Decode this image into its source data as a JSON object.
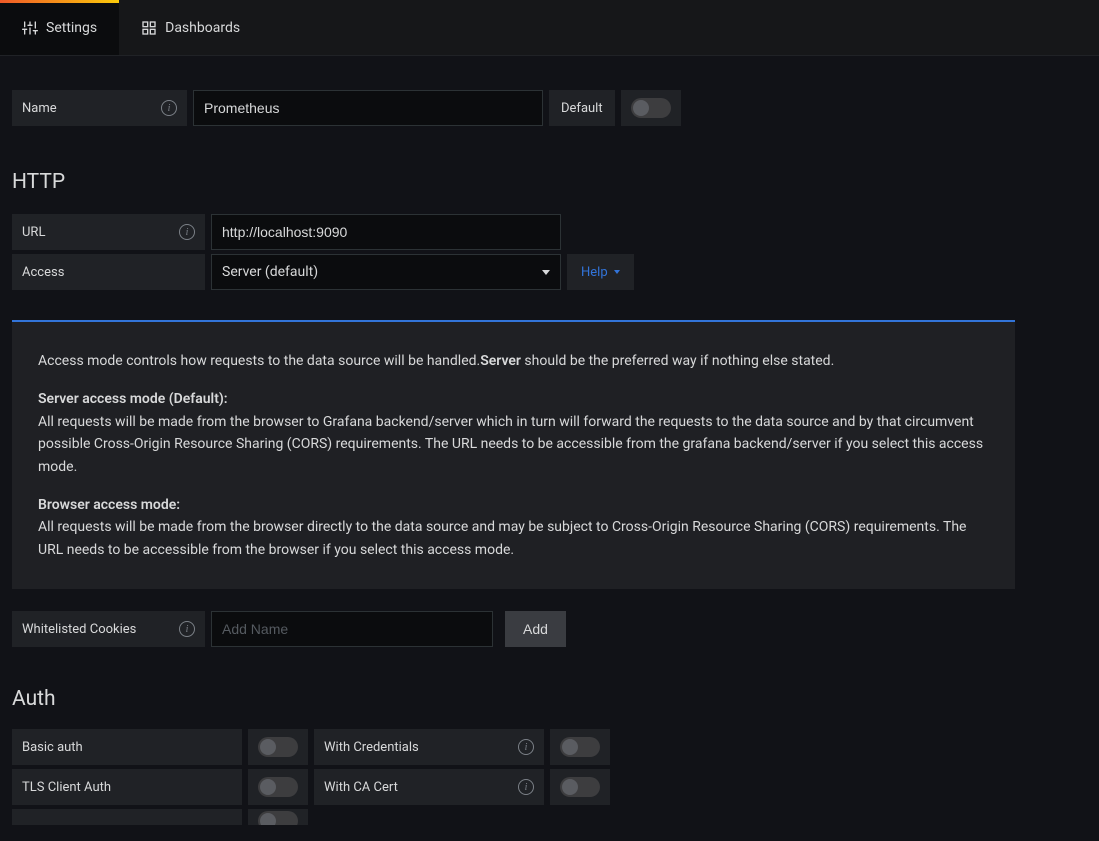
{
  "tabs": {
    "settings": "Settings",
    "dashboards": "Dashboards"
  },
  "fields": {
    "name_label": "Name",
    "name_value": "Prometheus",
    "default_label": "Default"
  },
  "http": {
    "title": "HTTP",
    "url_label": "URL",
    "url_value": "http://localhost:9090",
    "access_label": "Access",
    "access_value": "Server (default)",
    "help_label": "Help"
  },
  "info": {
    "intro_pre": "Access mode controls how requests to the data source will be handled.",
    "intro_bold": "Server",
    "intro_post": " should be the preferred way if nothing else stated.",
    "server_title": "Server access mode (Default):",
    "server_body": "All requests will be made from the browser to Grafana backend/server which in turn will forward the requests to the data source and by that circumvent possible Cross-Origin Resource Sharing (CORS) requirements. The URL needs to be accessible from the grafana backend/server if you select this access mode.",
    "browser_title": "Browser access mode:",
    "browser_body": "All requests will be made from the browser directly to the data source and may be subject to Cross-Origin Resource Sharing (CORS) requirements. The URL needs to be accessible from the browser if you select this access mode."
  },
  "cookies": {
    "label": "Whitelisted Cookies",
    "placeholder": "Add Name",
    "add_btn": "Add"
  },
  "auth": {
    "title": "Auth",
    "basic": "Basic auth",
    "with_creds": "With Credentials",
    "tls_client": "TLS Client Auth",
    "ca_cert": "With CA Cert"
  }
}
